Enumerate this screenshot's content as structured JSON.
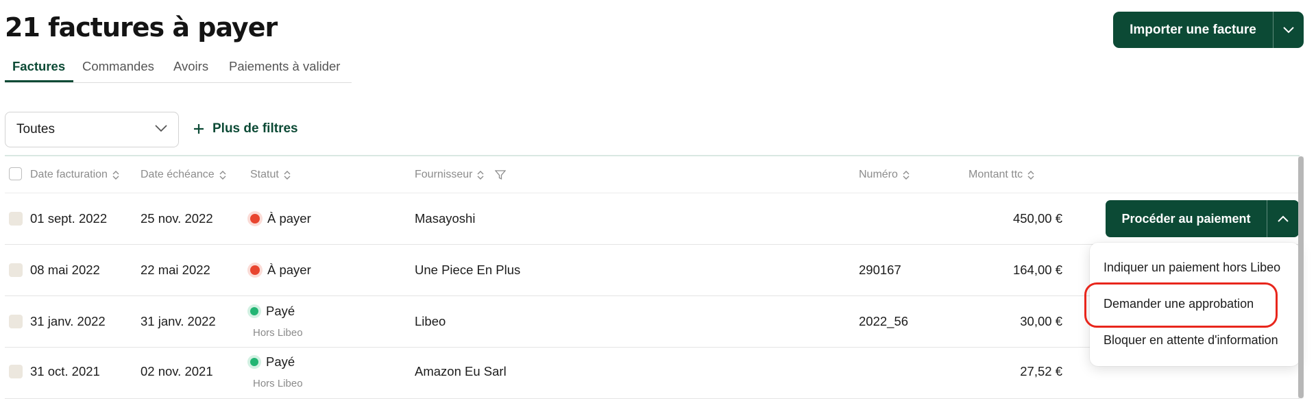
{
  "page": {
    "title": "21 factures à payer"
  },
  "actions": {
    "import_label": "Importer une facture"
  },
  "tabs": [
    {
      "label": "Factures",
      "active": true
    },
    {
      "label": "Commandes",
      "active": false
    },
    {
      "label": "Avoirs",
      "active": false
    },
    {
      "label": "Paiements à valider",
      "active": false
    }
  ],
  "filters": {
    "select_value": "Toutes",
    "more_filters_label": "Plus de filtres"
  },
  "table": {
    "columns": [
      "Date facturation",
      "Date échéance",
      "Statut",
      "Fournisseur",
      "Numéro",
      "Montant ttc"
    ],
    "rows": [
      {
        "date_facturation": "01 sept. 2022",
        "date_echeance": "25 nov. 2022",
        "statut": "À payer",
        "statut_detail": "",
        "fournisseur": "Masayoshi",
        "numero": "",
        "montant": "450,00 €"
      },
      {
        "date_facturation": "08 mai 2022",
        "date_echeance": "22 mai 2022",
        "statut": "À payer",
        "statut_detail": "",
        "fournisseur": "Une Piece En Plus",
        "numero": "290167",
        "montant": "164,00 €"
      },
      {
        "date_facturation": "31 janv. 2022",
        "date_echeance": "31 janv. 2022",
        "statut": "Payé",
        "statut_detail": "Hors Libeo",
        "fournisseur": "Libeo",
        "numero": "2022_56",
        "montant": "30,00 €"
      },
      {
        "date_facturation": "31 oct. 2021",
        "date_echeance": "02 nov. 2021",
        "statut": "Payé",
        "statut_detail": "Hors Libeo",
        "fournisseur": "Amazon Eu Sarl",
        "numero": "",
        "montant": "27,52 €"
      }
    ]
  },
  "row_action": {
    "pay_label": "Procéder au paiement",
    "menu_items": [
      "Indiquer un paiement hors Libeo",
      "Demander une approbation",
      "Bloquer en attente d'information"
    ]
  },
  "colors": {
    "brand": "#0c4a35",
    "status_to_pay": "#e8452f",
    "status_paid": "#22b573",
    "highlight": "#e8261c"
  }
}
